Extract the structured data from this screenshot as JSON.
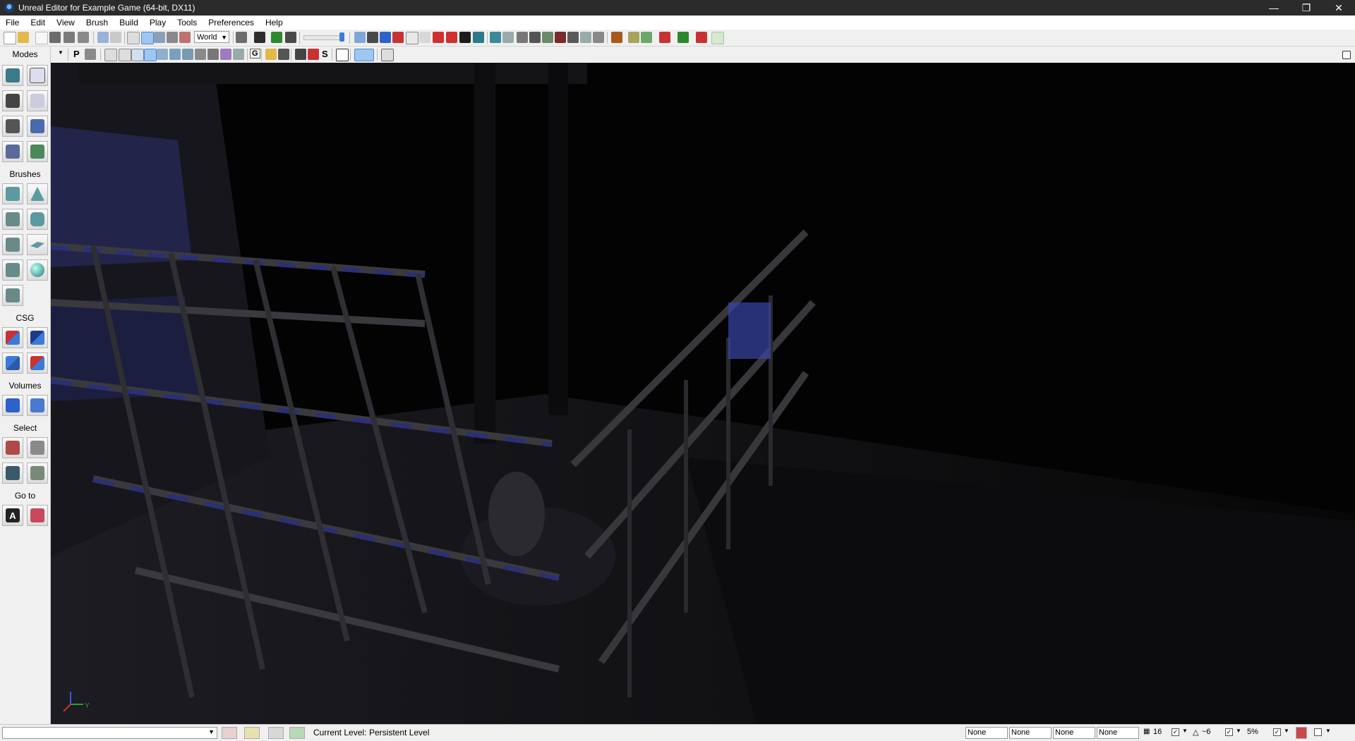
{
  "window": {
    "title": "Unreal Editor for Example Game (64-bit, DX11)",
    "controls": [
      "—",
      "❐",
      "✕"
    ]
  },
  "menu": [
    "File",
    "Edit",
    "View",
    "Brush",
    "Build",
    "Play",
    "Tools",
    "Preferences",
    "Help"
  ],
  "toolbar": {
    "coordinate_system": "World",
    "letter_p": "P",
    "letter_g": "G",
    "letter_s": "S"
  },
  "modes_panel": {
    "title": "Modes",
    "sections": [
      "Brushes",
      "CSG",
      "Volumes",
      "Select",
      "Go to"
    ]
  },
  "statusbar": {
    "current_level_label": "Current Level:",
    "current_level_value": "Persistent Level",
    "fields": [
      "None",
      "None",
      "None",
      "None"
    ],
    "grid_size": "16",
    "rotation_snap": "~6",
    "scale_snap": "5%"
  },
  "colors": {
    "title_bg": "#2b2b2b",
    "viewport_bg": "#030303",
    "brush_blue": "#2a2f78",
    "metal_grey": "#3a3a3e",
    "accent_blue": "#3b7bd8"
  }
}
